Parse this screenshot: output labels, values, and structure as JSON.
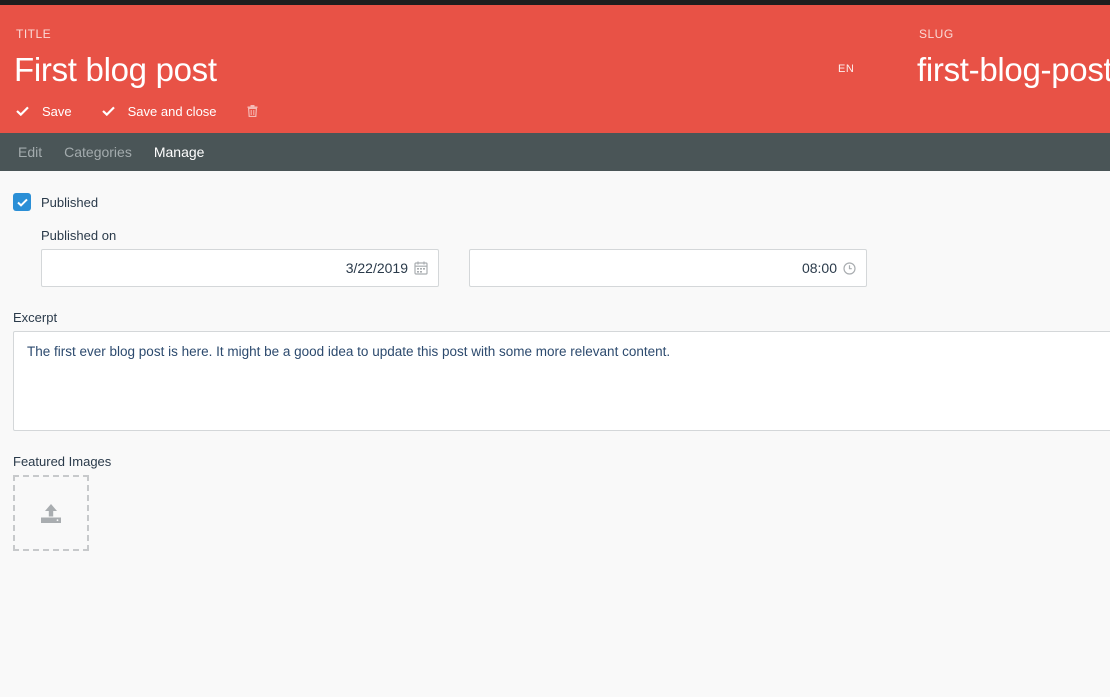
{
  "header": {
    "title_label": "TITLE",
    "title_value": "First blog post",
    "lang": "EN",
    "slug_label": "SLUG",
    "slug_value": "first-blog-post",
    "save_label": "Save",
    "save_close_label": "Save and close"
  },
  "tabs": [
    {
      "label": "Edit",
      "active": false
    },
    {
      "label": "Categories",
      "active": false
    },
    {
      "label": "Manage",
      "active": true
    }
  ],
  "form": {
    "published_label": "Published",
    "published_checked": true,
    "published_on_label": "Published on",
    "date_value": "3/22/2019",
    "time_value": "08:00",
    "excerpt_label": "Excerpt",
    "excerpt_value": "The first ever blog post is here. It might be a good idea to update this post with some more relevant content.",
    "featured_label": "Featured Images"
  },
  "colors": {
    "header_bg": "#e85246",
    "tabs_bg": "#4a5557",
    "checkbox": "#2b8fd6"
  }
}
